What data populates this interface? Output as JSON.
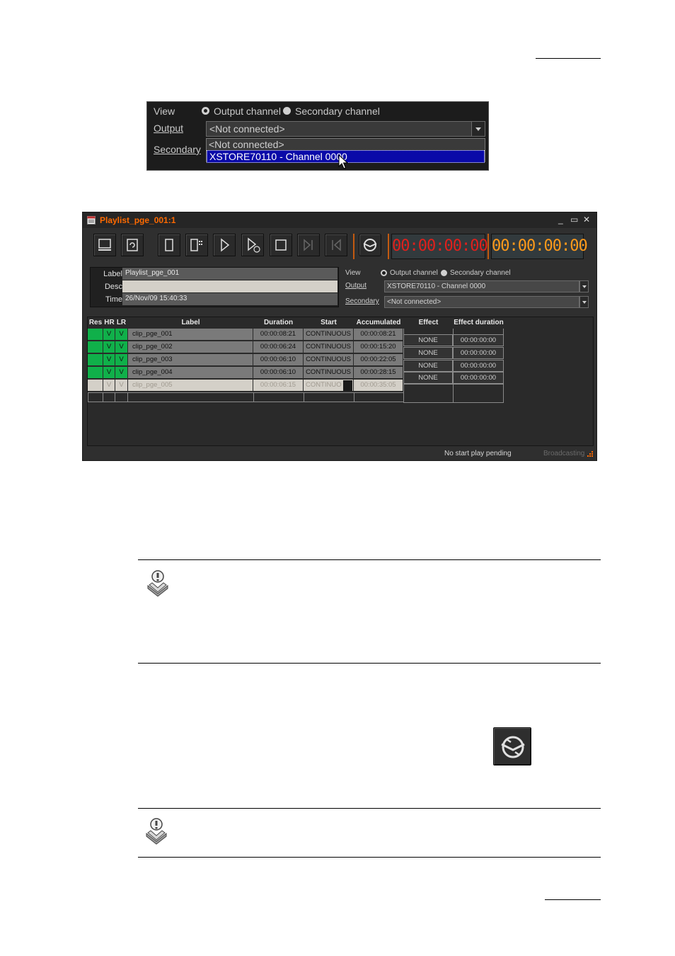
{
  "dropdown": {
    "view_label": "View",
    "output_label": "Output",
    "secondary_label": "Secondary",
    "radio_output": "Output channel",
    "radio_secondary": "Secondary channel",
    "output_value": "<Not connected>",
    "options": [
      "<Not connected>",
      "XSTORE70110 - Channel 0000"
    ]
  },
  "playlist": {
    "title": "Playlist_pge_001:1",
    "timecode_red": "00:00:00:00",
    "timecode_orange": "00:00:00:00",
    "colors": {
      "title": "#ff6a00",
      "tc_red": "#e0201c",
      "tc_orange": "#ff9a1a",
      "ready_green": "#10b04a"
    },
    "info": {
      "label_label": "Label",
      "label_value": "Playlist_pge_001",
      "desc_label": "Desc",
      "desc_value": "",
      "time_label": "Time",
      "time_value": "26/Nov/09 15:40:33"
    },
    "view": {
      "view_label": "View",
      "radio_output": "Output channel",
      "radio_secondary": "Secondary channel",
      "output_label": "Output",
      "output_value": "XSTORE70110 - Channel 0000",
      "secondary_label": "Secondary",
      "secondary_value": "<Not connected>"
    },
    "columns": [
      "Res",
      "HR",
      "LR",
      "Label",
      "Duration",
      "Start",
      "Accumulated",
      "Effect",
      "Effect duration"
    ],
    "rows": [
      {
        "hr": "V",
        "lr": "V",
        "label": "clip_pge_001",
        "duration": "00:00:08:21",
        "start": "CONTINUOUS",
        "accumulated": "00:00:08:21"
      },
      {
        "hr": "V",
        "lr": "V",
        "label": "clip_pge_002",
        "duration": "00:00:06:24",
        "start": "CONTINUOUS",
        "accumulated": "00:00:15:20"
      },
      {
        "hr": "V",
        "lr": "V",
        "label": "clip_pge_003",
        "duration": "00:00:06:10",
        "start": "CONTINUOUS",
        "accumulated": "00:00:22:05"
      },
      {
        "hr": "V",
        "lr": "V",
        "label": "clip_pge_004",
        "duration": "00:00:06:10",
        "start": "CONTINUOUS",
        "accumulated": "00:00:28:15"
      },
      {
        "hr": "V",
        "lr": "V",
        "label": "clip_pge_005",
        "duration": "00:00:06:15",
        "start": "CONTINUO",
        "accumulated": "00:00:35:05"
      }
    ],
    "effects": [
      {
        "effect": "NONE",
        "duration": "00:00:00:00"
      },
      {
        "effect": "NONE",
        "duration": "00:00:00:00"
      },
      {
        "effect": "NONE",
        "duration": "00:00:00:00"
      },
      {
        "effect": "NONE",
        "duration": "00:00:00:00"
      }
    ],
    "status_text": "No start play pending",
    "broadcasting_text": "Broadcasting"
  }
}
